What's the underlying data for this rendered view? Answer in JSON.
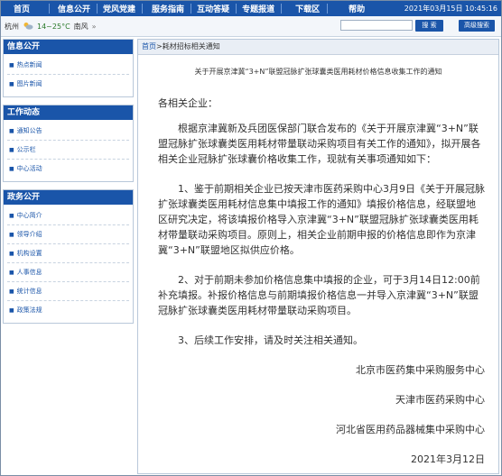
{
  "nav": {
    "items": [
      "首页",
      "信息公开",
      "党风党建",
      "服务指南",
      "互动答疑",
      "专题报道",
      "下载区",
      "帮助"
    ],
    "datetime": "2021年03月15日 10:45:16"
  },
  "weather": {
    "city": "杭州",
    "temp": "14~25°C",
    "wind": "南风",
    "icon": "weather-cloud-sun"
  },
  "search": {
    "placeholder": "",
    "button": "搜 索",
    "advanced": "高级搜索"
  },
  "sidebar": {
    "sections": [
      {
        "title": "信息公开",
        "items": [
          "热点新闻",
          "图片新闻"
        ]
      },
      {
        "title": "工作动态",
        "items": [
          "通知公告",
          "公示栏",
          "中心活动"
        ]
      },
      {
        "title": "政务公开",
        "items": [
          "中心简介",
          "领导介绍",
          "机构设置",
          "人事信息",
          "统计信息",
          "政策法规"
        ]
      }
    ]
  },
  "breadcrumb": {
    "home": "首页",
    "sep": ">",
    "current": "耗材招标相关通知"
  },
  "article": {
    "title": "关于开展京津冀“3+N”联盟冠脉扩张球囊类医用耗材价格信息收集工作的通知",
    "greeting": "各相关企业：",
    "paragraphs": [
      "根据京津冀新及兵团医保部门联合发布的《关于开展京津冀“3+N”联盟冠脉扩张球囊类医用耗材带量联动采购项目有关工作的通知》，拟开展各相关企业冠脉扩张球囊价格收集工作，现就有关事项通知如下：",
      "1、鉴于前期相关企业已按天津市医药采购中心3月9日《关于开展冠脉扩张球囊类医用耗材信息集中填报工作的通知》填报价格信息，经联盟地区研究决定，将该填报价格导入京津冀“3+N”联盟冠脉扩张球囊类医用耗材带量联动采购项目。原则上，相关企业前期申报的价格信息即作为京津冀“3+N”联盟地区拟供应价格。",
      "2、对于前期未参加价格信息集中填报的企业，可于3月14日12:00前补充填报。补报价格信息与前期填报价格信息一并导入京津冀“3+N”联盟冠脉扩张球囊类医用耗材带量联动采购项目。",
      "3、后续工作安排，请及时关注相关通知。"
    ],
    "signatures": [
      "北京市医药集中采购服务中心",
      "天津市医药采购中心",
      "河北省医用药品器械集中采购中心"
    ],
    "date": "2021年3月12日"
  },
  "colors": {
    "nav_bg": "#1a55a9",
    "link": "#1a55a9",
    "page_border": "#7a8ea6"
  }
}
